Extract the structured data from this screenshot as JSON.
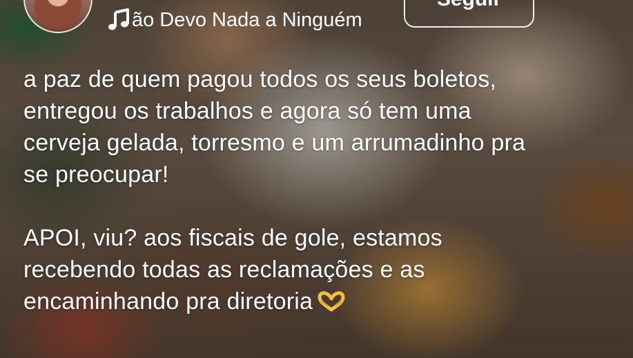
{
  "header": {
    "song_title": "Não Devo Nada a Ninguém",
    "follow_label": "Seguir",
    "music_icon": "music-note-icon",
    "avatar": "profile-avatar"
  },
  "caption": {
    "paragraph_1": "a paz de quem pagou todos os seus boletos,\nentregou os trabalhos e agora só tem uma\ncerveja gelada, torresmo e um arrumadinho pra\nse preocupar!",
    "paragraph_2": "APOI, viu? aos fiscais de gole, estamos\nrecebendo todas as reclamações e as\nencaminhando pra diretoria",
    "emoji": "heart-hands-emoji"
  },
  "colors": {
    "text": "#ffffff",
    "emoji": "#f2c23a"
  }
}
